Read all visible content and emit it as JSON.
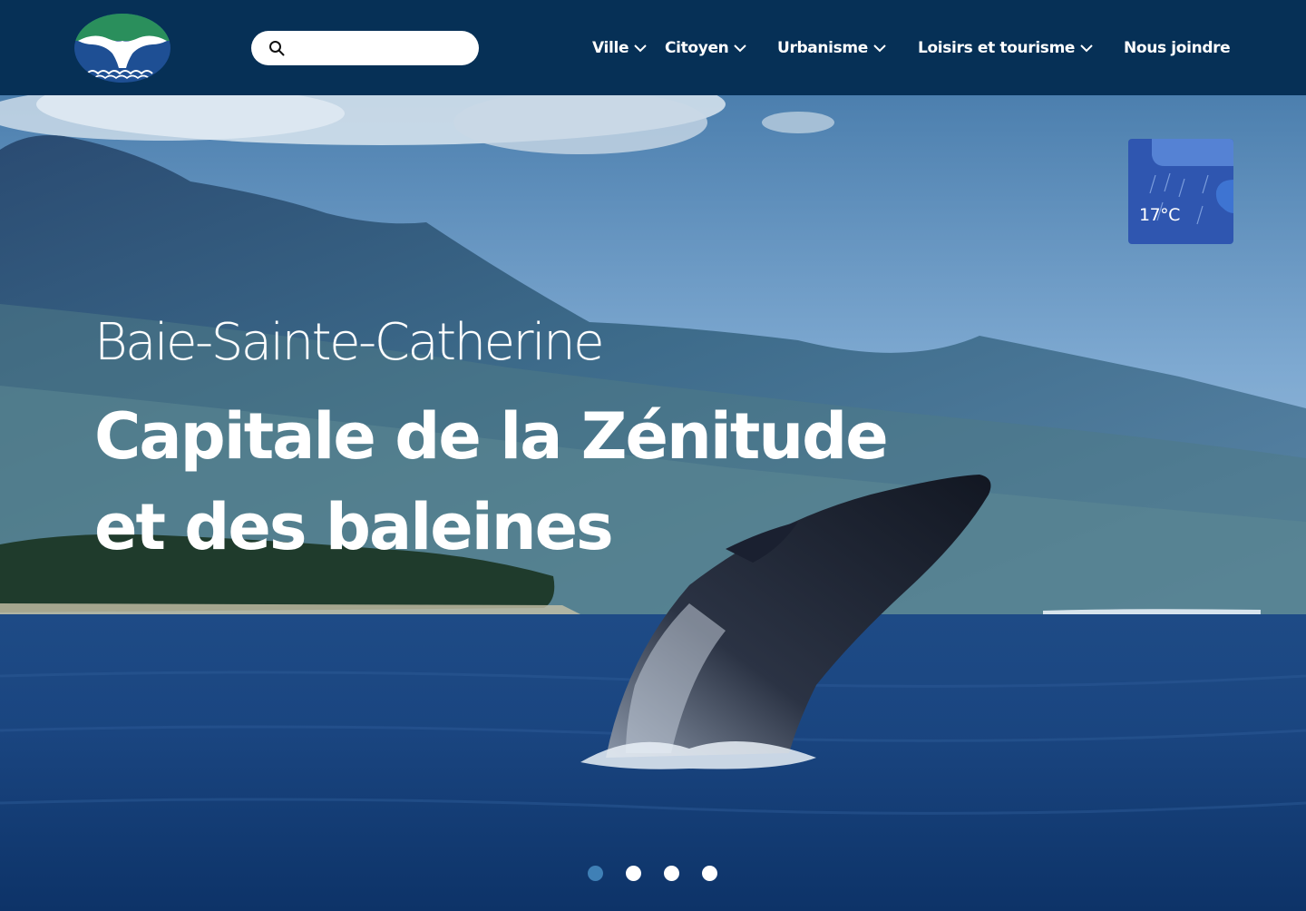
{
  "header": {
    "logo_alt": "Baie-Sainte-Catherine",
    "search": {
      "placeholder": "",
      "value": ""
    },
    "nav": [
      {
        "label": "Ville",
        "has_dropdown": true
      },
      {
        "label": "Citoyen",
        "has_dropdown": true
      },
      {
        "label": "Urbanisme",
        "has_dropdown": true
      },
      {
        "label": "Loisirs et tourisme",
        "has_dropdown": true
      },
      {
        "label": "Nous joindre",
        "has_dropdown": false
      }
    ]
  },
  "hero": {
    "subtitle": "Baie-Sainte-Catherine",
    "title_line_1": "Capitale de la Zénitude",
    "title_line_2": "et des baleines",
    "weather": {
      "temperature": "17°C",
      "icon": "rain-cloud-icon"
    },
    "carousel": {
      "slide_count": 4,
      "active_index": 0
    }
  },
  "colors": {
    "header_bg": "#063056",
    "logo_green": "#2a8f5c",
    "logo_blue": "#1e4f94",
    "weather_bg": "#2f56b0",
    "dot_active": "#3f80b6",
    "dot_inactive": "#ffffff"
  }
}
